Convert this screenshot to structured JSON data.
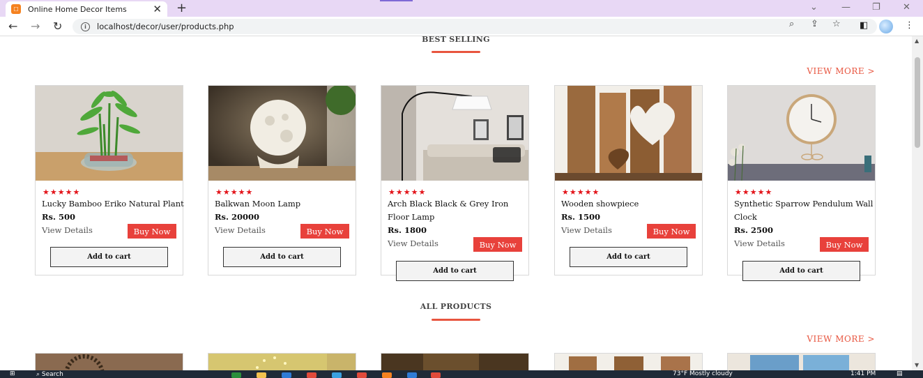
{
  "browser": {
    "tab_title": "Online Home Decor Items",
    "url": "localhost/decor/user/products.php"
  },
  "best_selling": {
    "title": "BEST SELLING",
    "view_more": "VIEW MORE >",
    "products": [
      {
        "stars": "★★★★★",
        "name": "Lucky Bamboo Eriko Natural Plant",
        "price": "Rs. 500",
        "details": "View Details",
        "buy": "Buy Now",
        "cart": "Add to cart"
      },
      {
        "stars": "★★★★★",
        "name": "Balkwan Moon Lamp",
        "price": "Rs. 20000",
        "details": "View Details",
        "buy": "Buy Now",
        "cart": "Add to cart"
      },
      {
        "stars": "★★★★★",
        "name": "Arch Black Black & Grey Iron Floor Lamp",
        "price": "Rs. 1800",
        "details": "View Details",
        "buy": "Buy Now",
        "cart": "Add to cart"
      },
      {
        "stars": "★★★★★",
        "name": "Wooden showpiece",
        "price": "Rs. 1500",
        "details": "View Details",
        "buy": "Buy Now",
        "cart": "Add to cart"
      },
      {
        "stars": "★★★★★",
        "name": "Synthetic Sparrow Pendulum Wall Clock",
        "price": "Rs. 2500",
        "details": "View Details",
        "buy": "Buy Now",
        "cart": "Add to cart"
      }
    ]
  },
  "all_products": {
    "title": "ALL PRODUCTS",
    "view_more": "VIEW MORE >"
  },
  "taskbar": {
    "search": "Search",
    "weather": "73°F  Mostly cloudy",
    "time": "1:41 PM"
  }
}
